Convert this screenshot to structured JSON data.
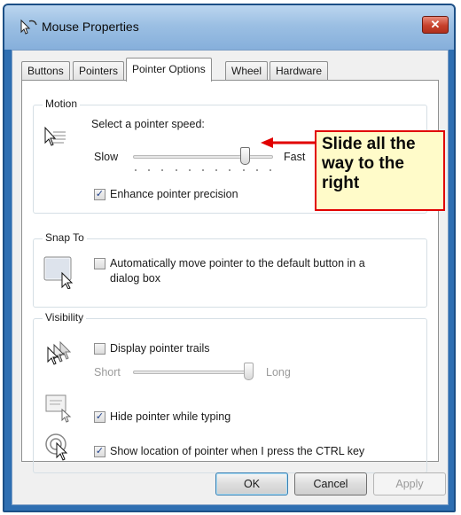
{
  "window": {
    "title": "Mouse Properties",
    "close_glyph": "✕"
  },
  "tabs": [
    {
      "label": "Buttons"
    },
    {
      "label": "Pointers"
    },
    {
      "label": "Pointer Options"
    },
    {
      "label": "Wheel"
    },
    {
      "label": "Hardware"
    }
  ],
  "active_tab": "Pointer Options",
  "motion": {
    "title": "Motion",
    "speed_label": "Select a pointer speed:",
    "slow_label": "Slow",
    "fast_label": "Fast",
    "speed_level": 0.82,
    "precision_label": "Enhance pointer precision",
    "precision_checked": true,
    "icon": "pointer-speed-icon"
  },
  "snap_to": {
    "title": "Snap To",
    "label_line1": "Automatically move pointer to the default button in a",
    "label_line2": "dialog box",
    "checked": false,
    "icon": "snap-to-icon"
  },
  "visibility": {
    "title": "Visibility",
    "trails_label": "Display pointer trails",
    "trails_checked": false,
    "short_label": "Short",
    "long_label": "Long",
    "trails_level": 1.0,
    "hide_label": "Hide pointer while typing",
    "hide_checked": true,
    "ctrl_label": "Show location of pointer when I press the CTRL key",
    "ctrl_checked": true,
    "icons": [
      "pointer-trails-icon",
      "hide-pointer-icon",
      "pointer-location-icon"
    ]
  },
  "buttons": {
    "ok": "OK",
    "cancel": "Cancel",
    "apply": "Apply"
  },
  "callout": {
    "line1": "Slide all the",
    "line2": "way to the",
    "line3": "right",
    "border_color": "#e10000",
    "background": "#fffbc9"
  },
  "colors": {
    "frame": "#2f6fb2",
    "titlebar": "#9bbfe3",
    "close": "#c7402b",
    "check": "#1e3f8a"
  },
  "check_glyph": "✓"
}
